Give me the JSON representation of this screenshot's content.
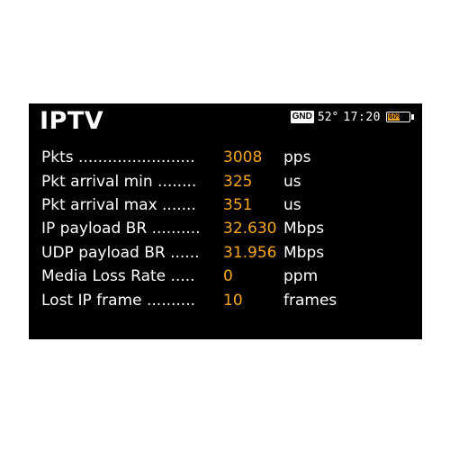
{
  "screen": {
    "title": "IPTV",
    "status": {
      "gnd_label": "GND",
      "temperature": "52°",
      "time": "17:20",
      "battery_label": "60%",
      "battery_level": 0.6,
      "battery_color": "#f5a623"
    }
  },
  "colors": {
    "background": "#000000",
    "label": "#ffffff",
    "value": "#f5a623"
  },
  "measurements": [
    {
      "label": "Pkts ........................",
      "value": "3008",
      "unit": "pps"
    },
    {
      "label": "Pkt arrival min ........",
      "value": "325",
      "unit": "us"
    },
    {
      "label": "Pkt arrival max .......",
      "value": "351",
      "unit": "us"
    },
    {
      "label": "IP payload BR ..........",
      "value": "32.630",
      "unit": "Mbps"
    },
    {
      "label": "UDP payload BR ......",
      "value": "31.956",
      "unit": "Mbps"
    },
    {
      "label": "Media Loss Rate .....",
      "value": "0",
      "unit": "ppm"
    },
    {
      "label": "Lost IP frame ..........",
      "value": "10",
      "unit": "frames"
    }
  ]
}
